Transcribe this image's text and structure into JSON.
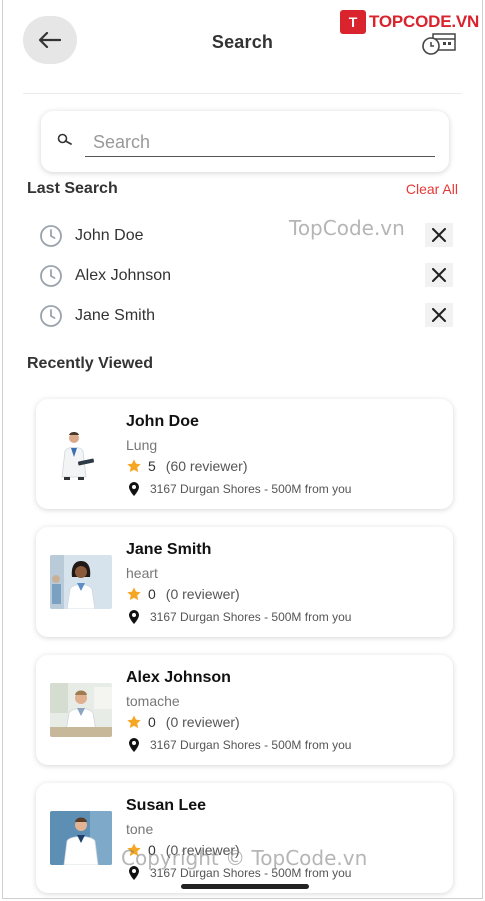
{
  "header": {
    "title": "Search",
    "brand_mark": "T",
    "brand_text": "TOPCODE.VN"
  },
  "search": {
    "placeholder": "Search",
    "value": ""
  },
  "last_search": {
    "title": "Last Search",
    "clear_label": "Clear All",
    "items": [
      {
        "name": "John Doe"
      },
      {
        "name": "Alex Johnson"
      },
      {
        "name": "Jane Smith"
      }
    ]
  },
  "recently_viewed": {
    "title": "Recently Viewed",
    "doctors": [
      {
        "name": "John Doe",
        "specialty": "Lung",
        "rating": "5",
        "reviews": "(60 reviewer)",
        "address": "3167 Durgan Shores - 500M from you"
      },
      {
        "name": "Jane Smith",
        "specialty": "heart",
        "rating": "0",
        "reviews": "(0 reviewer)",
        "address": "3167 Durgan Shores - 500M from you"
      },
      {
        "name": "Alex Johnson",
        "specialty": "tomache",
        "rating": "0",
        "reviews": "(0 reviewer)",
        "address": "3167 Durgan Shores - 500M from you"
      },
      {
        "name": "Susan Lee",
        "specialty": "tone",
        "rating": "0",
        "reviews": "(0 reviewer)",
        "address": "3167 Durgan Shores - 500M from you"
      }
    ]
  },
  "watermarks": {
    "mid": "TopCode.vn",
    "bottom": "Copyright © TopCode.vn"
  },
  "colors": {
    "accent_red": "#e53935",
    "star": "#f5a623",
    "brand_red": "#d9232d"
  }
}
